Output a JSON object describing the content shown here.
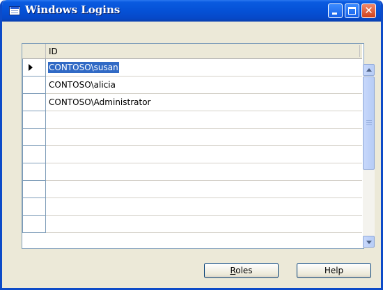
{
  "window": {
    "title": "Windows Logins",
    "title_icon": "table-window-icon",
    "controls": [
      "minimize-icon",
      "maximize-icon",
      "close-icon"
    ],
    "close_glyph": "✕"
  },
  "grid": {
    "column_header": "ID",
    "rows": [
      {
        "id": "CONTOSO\\susan",
        "selected": true
      },
      {
        "id": "CONTOSO\\alicia"
      },
      {
        "id": "CONTOSO\\Administrator"
      },
      {
        "id": ""
      },
      {
        "id": ""
      },
      {
        "id": ""
      },
      {
        "id": ""
      },
      {
        "id": ""
      },
      {
        "id": ""
      },
      {
        "id": ""
      }
    ],
    "lookup_icon": "lookup-arrow-icon"
  },
  "buttons": {
    "roles_mnemonic": "R",
    "roles_rest": "oles",
    "help": "Help"
  },
  "colors": {
    "titlebar": "#0551d6",
    "selection": "#316ac5",
    "dialog_bg": "#ece9d8"
  }
}
